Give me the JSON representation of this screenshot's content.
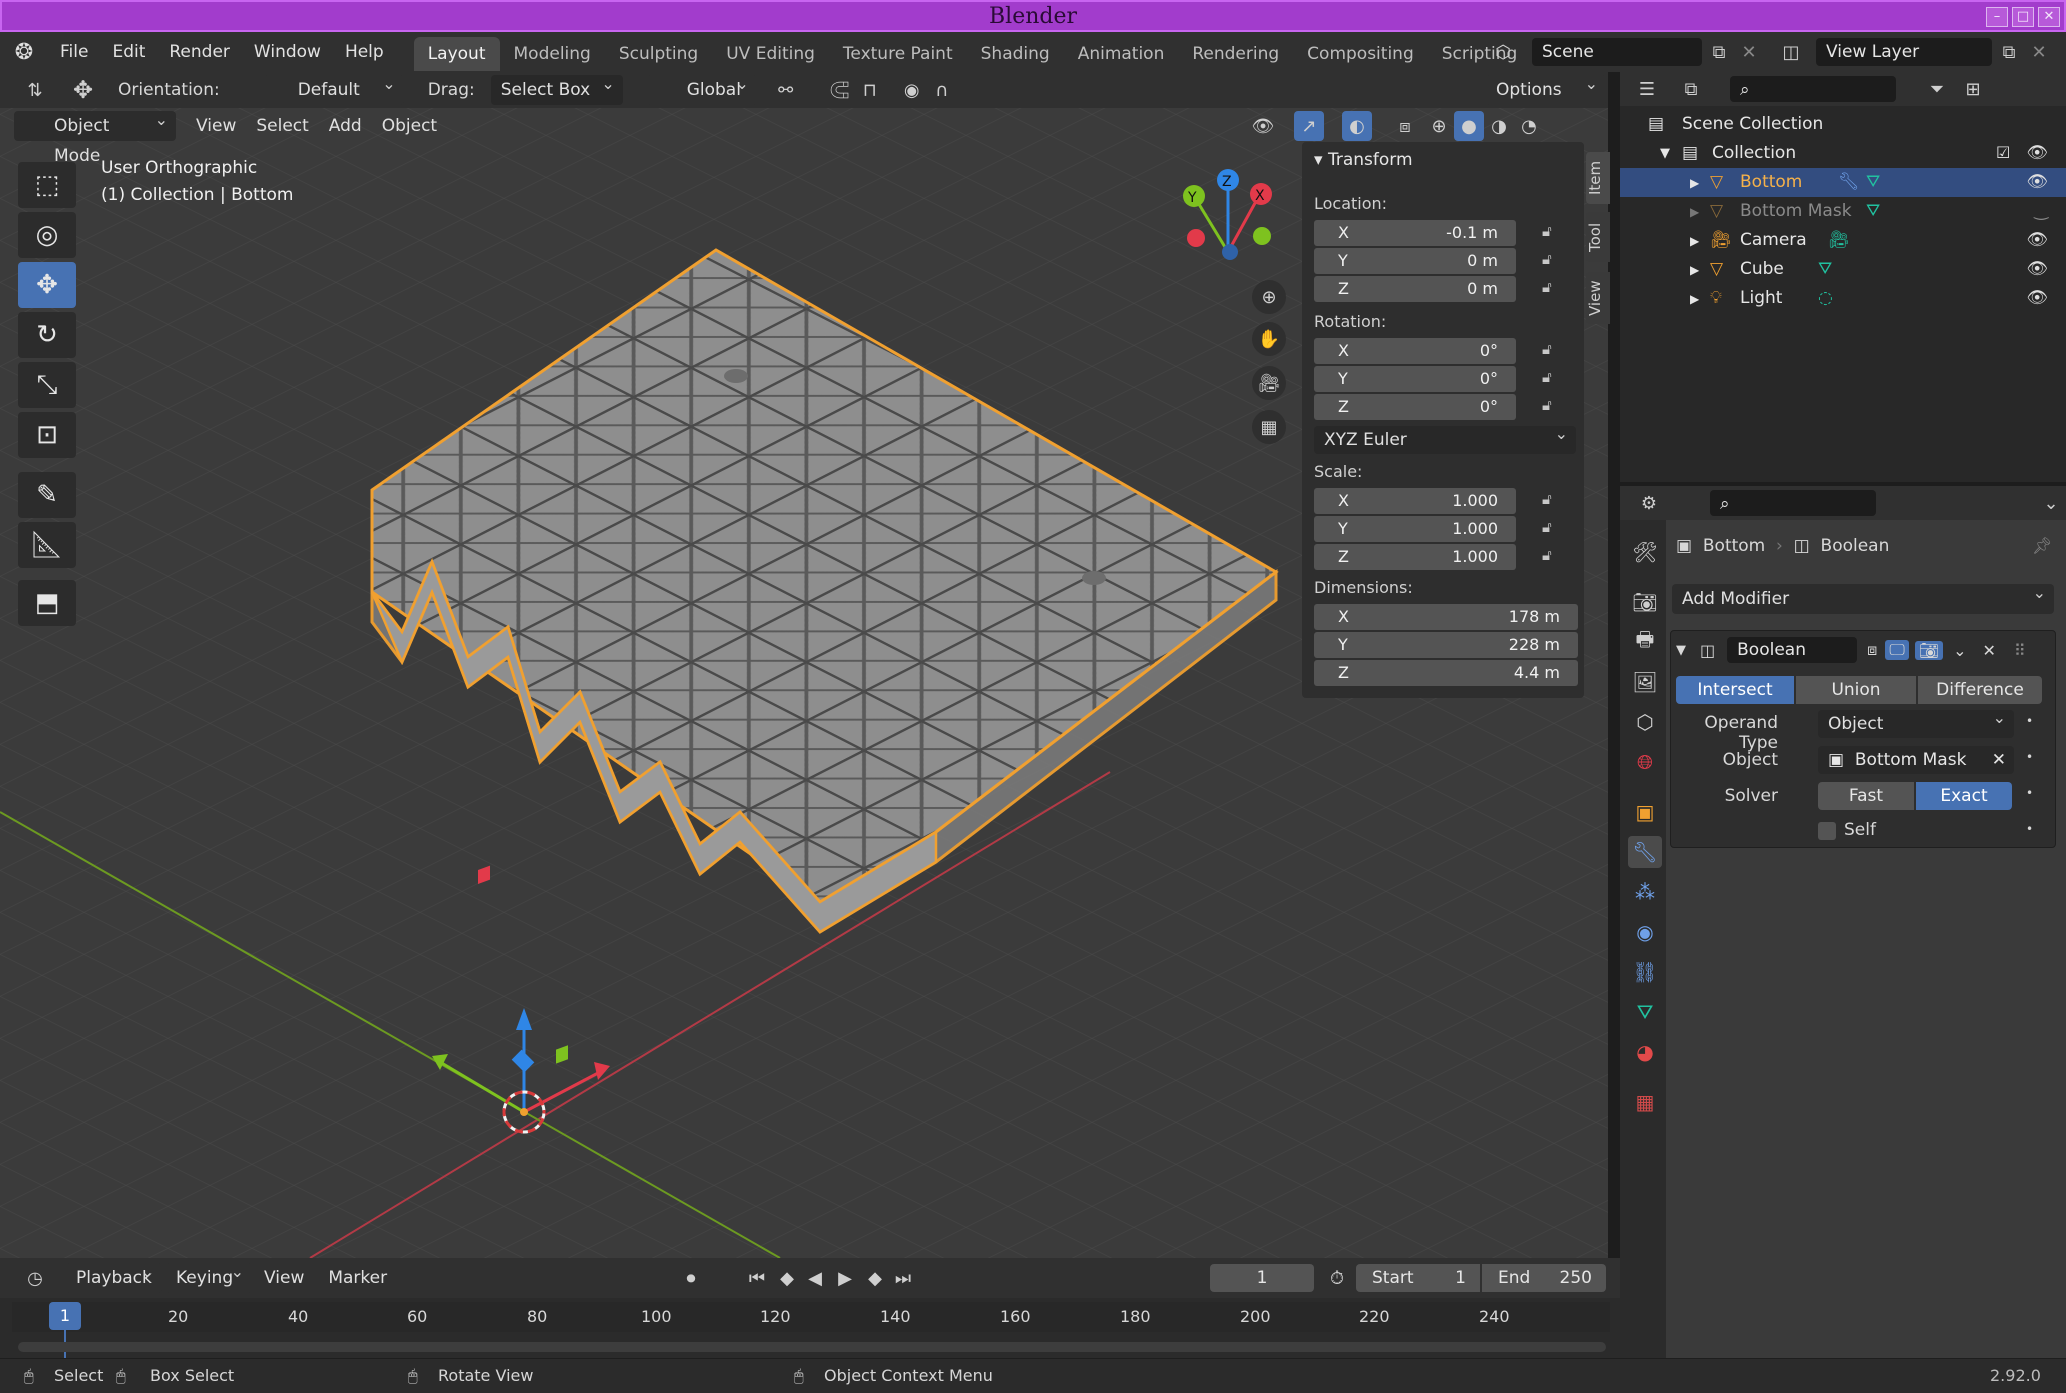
{
  "window": {
    "title": "Blender"
  },
  "menu": [
    "File",
    "Edit",
    "Render",
    "Window",
    "Help"
  ],
  "workspaces": [
    "Layout",
    "Modeling",
    "Sculpting",
    "UV Editing",
    "Texture Paint",
    "Shading",
    "Animation",
    "Rendering",
    "Compositing",
    "Scripting"
  ],
  "active_workspace": "Layout",
  "scene": {
    "name": "Scene",
    "view_layer": "View Layer"
  },
  "tool_header": {
    "orientation_label": "Orientation:",
    "orientation_value": "Default",
    "drag_label": "Drag:",
    "drag_value": "Select Box",
    "transform_orientation": "Global",
    "options": "Options"
  },
  "viewport_header": {
    "mode": "Object Mode",
    "menus": [
      "View",
      "Select",
      "Add",
      "Object"
    ]
  },
  "viewport": {
    "view_name": "User Orthographic",
    "collection_info": "(1) Collection | Bottom",
    "gizmo_axes": {
      "x": "X",
      "y": "Y",
      "z": "Z"
    }
  },
  "npanel": {
    "tabs": [
      "Item",
      "Tool",
      "View"
    ],
    "title": "Transform",
    "location_label": "Location:",
    "location": [
      {
        "axis": "X",
        "value": "-0.1 m"
      },
      {
        "axis": "Y",
        "value": "0 m"
      },
      {
        "axis": "Z",
        "value": "0 m"
      }
    ],
    "rotation_label": "Rotation:",
    "rotation": [
      {
        "axis": "X",
        "value": "0°"
      },
      {
        "axis": "Y",
        "value": "0°"
      },
      {
        "axis": "Z",
        "value": "0°"
      }
    ],
    "rotation_mode": "XYZ Euler",
    "scale_label": "Scale:",
    "scale": [
      {
        "axis": "X",
        "value": "1.000"
      },
      {
        "axis": "Y",
        "value": "1.000"
      },
      {
        "axis": "Z",
        "value": "1.000"
      }
    ],
    "dimensions_label": "Dimensions:",
    "dimensions": [
      {
        "axis": "X",
        "value": "178 m"
      },
      {
        "axis": "Y",
        "value": "228 m"
      },
      {
        "axis": "Z",
        "value": "4.4 m"
      }
    ]
  },
  "outliner": {
    "root": "Scene Collection",
    "collection": "Collection",
    "items": [
      {
        "name": "Bottom",
        "selected": true
      },
      {
        "name": "Bottom Mask",
        "selected": false
      },
      {
        "name": "Camera",
        "selected": false
      },
      {
        "name": "Cube",
        "selected": false
      },
      {
        "name": "Light",
        "selected": false
      }
    ]
  },
  "properties": {
    "breadcrumb_object": "Bottom",
    "breadcrumb_modifier": "Boolean",
    "add_modifier": "Add Modifier",
    "modifier_name": "Boolean",
    "operations": [
      "Intersect",
      "Union",
      "Difference"
    ],
    "active_operation": "Intersect",
    "operand_type_label": "Operand Type",
    "operand_type_value": "Object",
    "object_label": "Object",
    "object_value": "Bottom Mask",
    "solver_label": "Solver",
    "solver_options": [
      "Fast",
      "Exact"
    ],
    "active_solver": "Exact",
    "self_label": "Self"
  },
  "timeline": {
    "menus": [
      "Playback",
      "Keying",
      "View",
      "Marker"
    ],
    "current_frame": "1",
    "start_label": "Start",
    "start_value": "1",
    "end_label": "End",
    "end_value": "250",
    "ruler": [
      "20",
      "40",
      "60",
      "80",
      "100",
      "120",
      "140",
      "160",
      "180",
      "200",
      "220",
      "240"
    ],
    "playhead": "1"
  },
  "statusbar": {
    "select": "Select",
    "box_select": "Box Select",
    "rotate_view": "Rotate View",
    "context_menu": "Object Context Menu",
    "version": "2.92.0"
  },
  "colors": {
    "titlebar": "#a23ccc",
    "accent_blue": "#4772b3",
    "selection_orange": "#f0a030",
    "axis_x": "#e23a4a",
    "axis_y": "#7ec21f",
    "axis_z": "#2f86e6"
  }
}
